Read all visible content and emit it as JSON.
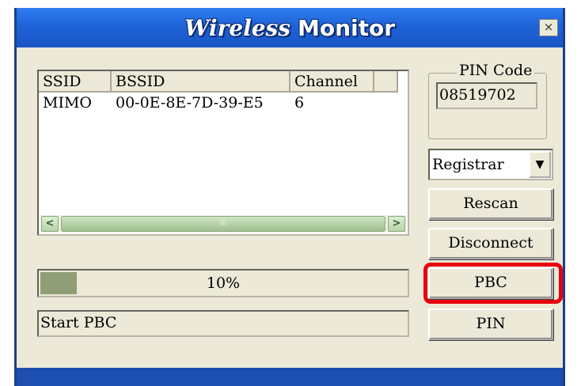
{
  "window": {
    "title_part1": "Wireless",
    "title_part2": "Monitor",
    "close_glyph": "×"
  },
  "list": {
    "columns": [
      "SSID",
      "BSSID",
      "Channel",
      ""
    ],
    "rows": [
      {
        "ssid": "MIMO",
        "bssid": "00-0E-8E-7D-39-E5",
        "channel": "6"
      }
    ],
    "scroll_grip": "III"
  },
  "pin": {
    "group_label": "PIN Code",
    "value": "08519702"
  },
  "mode_select": {
    "selected": "Registrar",
    "arrow": "▼"
  },
  "buttons": {
    "rescan": "Rescan",
    "disconnect": "Disconnect",
    "pbc": "PBC",
    "pin": "PIN"
  },
  "progress": {
    "value": 10,
    "label": "10%"
  },
  "status_text": "Start PBC",
  "colors": {
    "highlight": "#e8000f",
    "progress_fill": "#8f9e74",
    "titlebar": "#1e63d8"
  }
}
